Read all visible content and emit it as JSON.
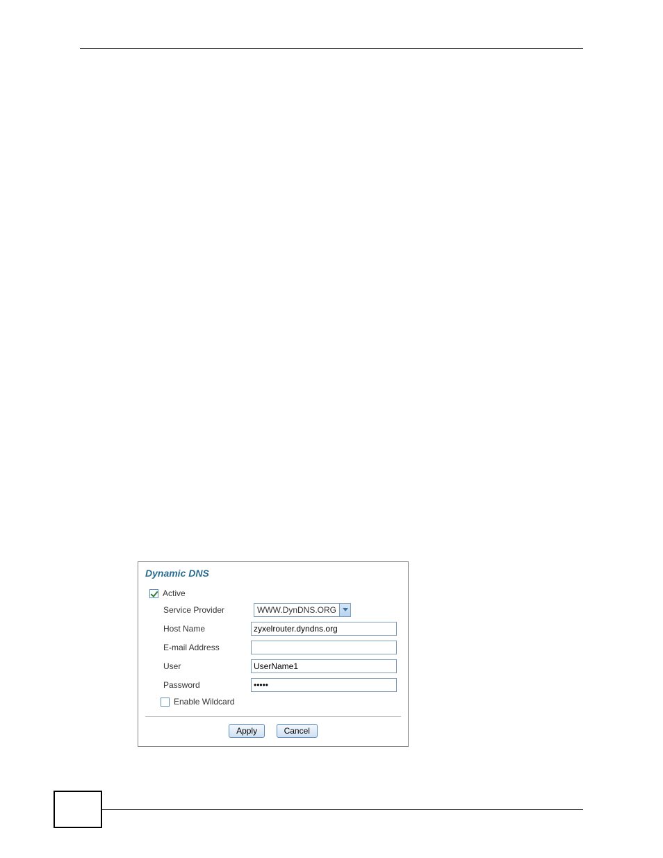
{
  "panel": {
    "title": "Dynamic DNS",
    "active_label": "Active",
    "active_checked": true,
    "service_provider_label": "Service Provider",
    "service_provider_value": "WWW.DynDNS.ORG",
    "host_name_label": "Host Name",
    "host_name_value": "zyxelrouter.dyndns.org",
    "email_label": "E-mail Address",
    "email_value": "",
    "user_label": "User",
    "user_value": "UserName1",
    "password_label": "Password",
    "password_value": "•••••",
    "wildcard_label": "Enable Wildcard",
    "wildcard_checked": false,
    "apply_label": "Apply",
    "cancel_label": "Cancel"
  }
}
